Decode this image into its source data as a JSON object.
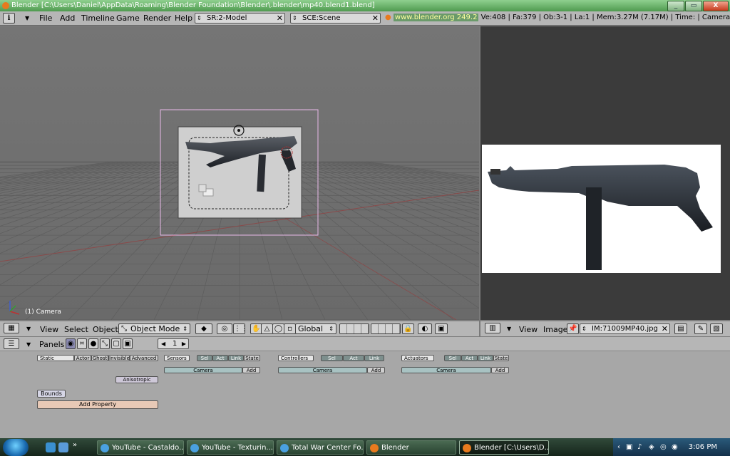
{
  "window": {
    "title": "Blender [C:\\Users\\Daniel\\AppData\\Roaming\\Blender Foundation\\Blender\\.blender\\mp40.blend1.blend]",
    "minimize": "_",
    "maximize": "▭",
    "close": "X"
  },
  "top_header": {
    "menus": [
      "File",
      "Add",
      "Timeline",
      "Game",
      "Render",
      "Help"
    ],
    "screen": "SR:2-Model",
    "scene": "SCE:Scene",
    "website": "www.blender.org",
    "version": "249.2",
    "stats": "Ve:408 | Fa:379 | Ob:3-1 | La:1  | Mem:3.27M (7.17M) | Time: | Camera"
  },
  "view3d": {
    "object_label": "(1) Camera"
  },
  "view3d_header": {
    "menus": [
      "View",
      "Select",
      "Object"
    ],
    "mode": "Object Mode",
    "orientation": "Global"
  },
  "image_header": {
    "menus": [
      "View",
      "Image"
    ],
    "image_name": "IM:71009MP40.jpg"
  },
  "buttons_window": {
    "panels_label": "Panels",
    "frame_value": "1",
    "physics_buttons": [
      "Static",
      "Actor",
      "Ghost",
      "Invisible",
      "Advanced"
    ],
    "anisotropic": "Anisotropic",
    "bounds": "Bounds",
    "add_property": "Add Property",
    "columns": [
      {
        "title": "Sensors",
        "tabs": [
          "Sel",
          "Act",
          "Link",
          "State"
        ],
        "object": "Camera",
        "add": "Add"
      },
      {
        "title": "Controllers",
        "tabs": [
          "Sel",
          "Act",
          "Link"
        ],
        "object": "Camera",
        "add": "Add"
      },
      {
        "title": "Actuators",
        "tabs": [
          "Sel",
          "Act",
          "Link",
          "State"
        ],
        "object": "Camera",
        "add": "Add"
      }
    ]
  },
  "taskbar": {
    "tasks": [
      {
        "label": "YouTube - Castaldo..."
      },
      {
        "label": "YouTube - Texturin..."
      },
      {
        "label": "Total War Center Fo..."
      },
      {
        "label": "Blender"
      },
      {
        "label": "Blender [C:\\Users\\D..."
      }
    ],
    "clock": "3:06 PM"
  }
}
